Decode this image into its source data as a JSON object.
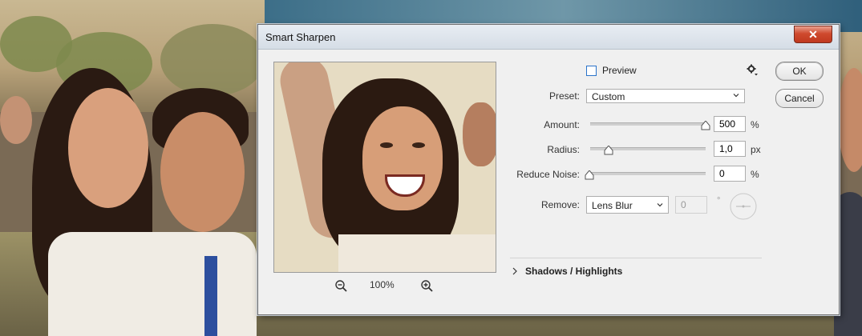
{
  "dialog": {
    "title": "Smart Sharpen",
    "close_glyph": "✕"
  },
  "preview": {
    "checkbox_label": "Preview",
    "checked": false,
    "zoom_level": "100%"
  },
  "settings": {
    "preset_label": "Preset:",
    "preset_value": "Custom",
    "amount_label": "Amount:",
    "amount_value": "500",
    "amount_unit": "%",
    "amount_fraction": 1.0,
    "radius_label": "Radius:",
    "radius_value": "1,0",
    "radius_unit": "px",
    "reduce_noise_label": "Reduce Noise:",
    "reduce_noise_value": "0",
    "reduce_noise_unit": "%",
    "remove_label": "Remove:",
    "remove_value": "Lens Blur",
    "angle_value": "0",
    "angle_unit": "°"
  },
  "shadows_highlights": {
    "label": "Shadows / Highlights",
    "expanded": false
  },
  "buttons": {
    "ok": "OK",
    "cancel": "Cancel"
  },
  "colors": {
    "accent": "#2a73c9",
    "close_red": "#c0391f"
  }
}
